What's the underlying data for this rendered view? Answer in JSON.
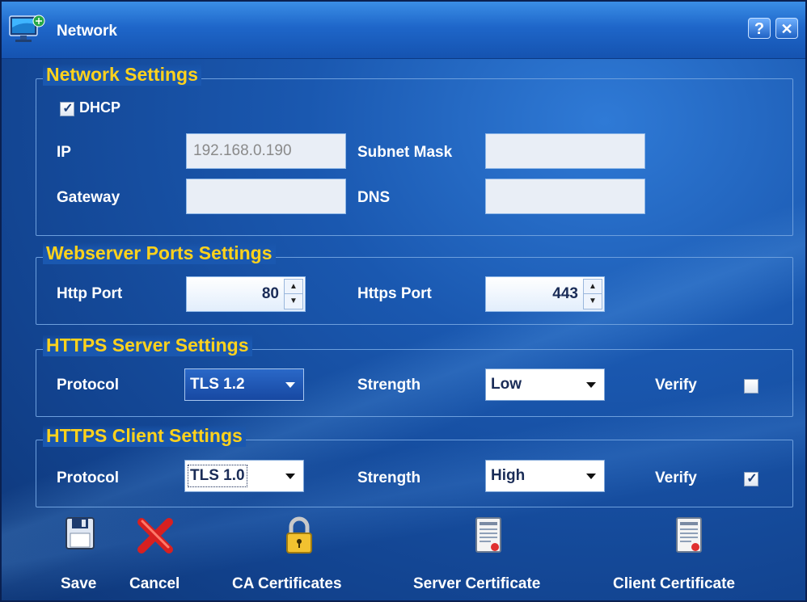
{
  "window": {
    "title": "Network",
    "help_label": "?",
    "close_label": "✕"
  },
  "network": {
    "legend": "Network Settings",
    "dhcp_label": "DHCP",
    "dhcp_checked": true,
    "ip_label": "IP",
    "ip_value": "192.168.0.190",
    "subnet_label": "Subnet Mask",
    "subnet_value": "",
    "gateway_label": "Gateway",
    "gateway_value": "",
    "dns_label": "DNS",
    "dns_value": ""
  },
  "ports": {
    "legend": "Webserver Ports Settings",
    "http_label": "Http Port",
    "http_value": "80",
    "https_label": "Https Port",
    "https_value": "443"
  },
  "server": {
    "legend": "HTTPS Server Settings",
    "protocol_label": "Protocol",
    "protocol_value": "TLS 1.2",
    "strength_label": "Strength",
    "strength_value": "Low",
    "verify_label": "Verify",
    "verify_checked": false
  },
  "client": {
    "legend": "HTTPS Client Settings",
    "protocol_label": "Protocol",
    "protocol_value": "TLS 1.0",
    "strength_label": "Strength",
    "strength_value": "High",
    "verify_label": "Verify",
    "verify_checked": true
  },
  "toolbar": {
    "save_label": "Save",
    "cancel_label": "Cancel",
    "ca_label": "CA Certificates",
    "server_cert_label": "Server Certificate",
    "client_cert_label": "Client Certificate"
  },
  "icons": {
    "app": "monitor-network-icon",
    "save": "floppy-disk-icon",
    "cancel": "red-x-icon",
    "ca": "padlock-icon",
    "server_cert": "certificate-document-icon",
    "client_cert": "certificate-document-icon"
  }
}
